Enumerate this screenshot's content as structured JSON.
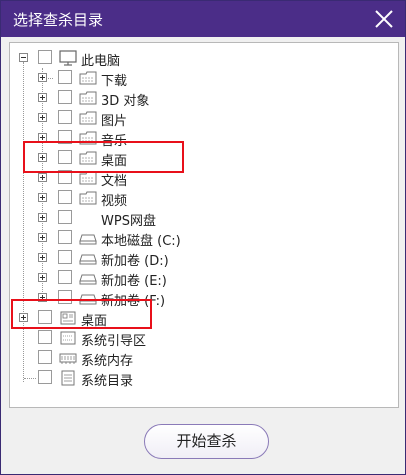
{
  "dialog": {
    "title": "选择查杀目录",
    "start_button": "开始查杀"
  },
  "tree": {
    "root": "此电脑",
    "children": [
      {
        "label": "下载",
        "icon": "folder-icon"
      },
      {
        "label": "3D 对象",
        "icon": "folder-icon"
      },
      {
        "label": "图片",
        "icon": "folder-icon"
      },
      {
        "label": "音乐",
        "icon": "folder-icon"
      },
      {
        "label": "桌面",
        "icon": "folder-icon"
      },
      {
        "label": "文档",
        "icon": "folder-icon"
      },
      {
        "label": "视频",
        "icon": "folder-icon"
      },
      {
        "label": "WPS网盘",
        "icon": "none"
      },
      {
        "label": "本地磁盘 (C:)",
        "icon": "drive-icon"
      },
      {
        "label": "新加卷 (D:)",
        "icon": "drive-icon"
      },
      {
        "label": "新加卷 (E:)",
        "icon": "drive-icon"
      },
      {
        "label": "新加卷 (F:)",
        "icon": "drive-icon"
      }
    ],
    "top_level": [
      {
        "label": "桌面",
        "icon": "desktop-icon"
      },
      {
        "label": "系统引导区",
        "icon": "boot-sector-icon"
      },
      {
        "label": "系统内存",
        "icon": "memory-icon"
      },
      {
        "label": "系统目录",
        "icon": "system-folder-icon"
      }
    ]
  },
  "colors": {
    "title_bar": "#4b2d88",
    "highlight": "#e8101a"
  }
}
